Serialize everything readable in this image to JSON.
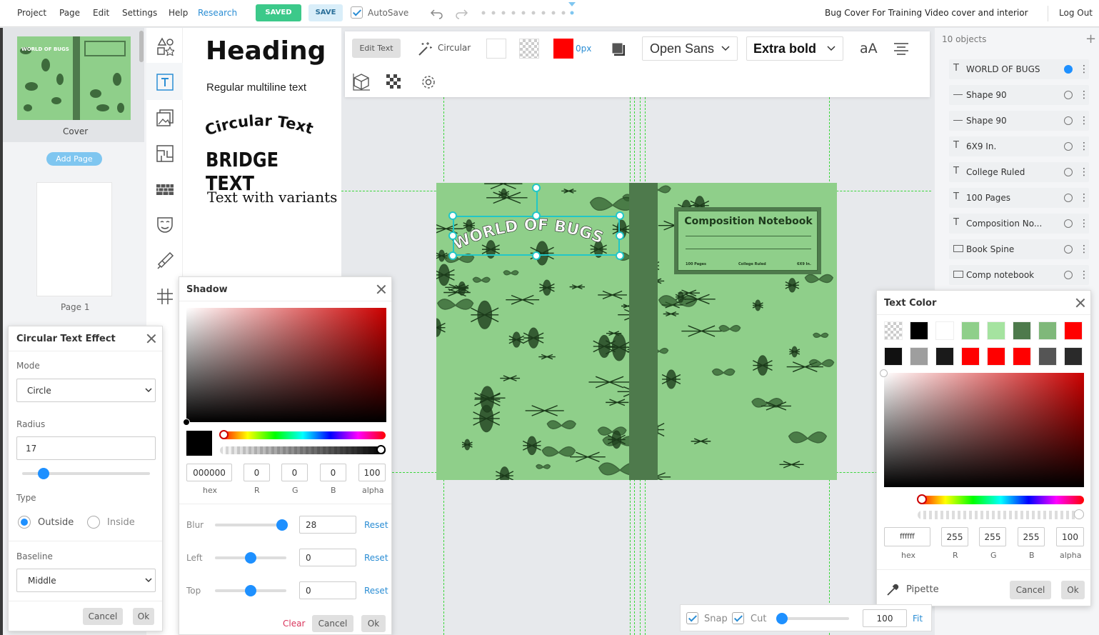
{
  "menu": {
    "project": "Project",
    "page": "Page",
    "edit": "Edit",
    "settings": "Settings",
    "help": "Help",
    "research": "Research"
  },
  "topbar": {
    "saved": "SAVED",
    "save": "SAVE",
    "autosave": "AutoSave",
    "document_title": "Bug Cover For Training Video cover and interior",
    "logout": "Log Out"
  },
  "pages": {
    "cover_label": "Cover",
    "add_page": "Add Page",
    "page1_label": "Page 1"
  },
  "text_presets": {
    "heading": "Heading",
    "multiline": "Regular multiline text",
    "circular": "Circular Text",
    "bridge": "BRIDGE TEXT",
    "variants": "Text with variants"
  },
  "toolbar": {
    "edit_text": "Edit Text",
    "circular": "Circular",
    "stroke_width": "0px",
    "font_family": "Open Sans",
    "font_weight": "Extra bold",
    "text_case": "aA",
    "fill_color": "#ff0000"
  },
  "layers": {
    "count": "10 objects",
    "items": [
      {
        "label": "WORLD OF BUGS",
        "icon": "text-icon"
      },
      {
        "label": "Shape 90",
        "icon": "line-icon"
      },
      {
        "label": "Shape 90",
        "icon": "line-icon"
      },
      {
        "label": "6X9 In.",
        "icon": "text-icon"
      },
      {
        "label": "College Ruled",
        "icon": "text-icon"
      },
      {
        "label": "100 Pages",
        "icon": "text-icon"
      },
      {
        "label": "Composition No...",
        "icon": "text-icon"
      },
      {
        "label": "Book Spine",
        "icon": "rect-icon"
      },
      {
        "label": "Comp notebook",
        "icon": "rect-icon"
      }
    ]
  },
  "canvas": {
    "cover_title": "WORLD OF BUGS",
    "notebook_title": "Composition Notebook",
    "meta_pages": "100 Pages",
    "meta_ruled": "College Ruled",
    "meta_size": "6X9 In.",
    "cover_color": "#8fcf8a",
    "spine_color": "#4e7a4c"
  },
  "circular_panel": {
    "title": "Circular Text Effect",
    "mode_label": "Mode",
    "mode_value": "Circle",
    "radius_label": "Radius",
    "radius_value": "17",
    "radius_slider": 0.17,
    "type_label": "Type",
    "outside": "Outside",
    "inside": "Inside",
    "baseline_label": "Baseline",
    "baseline_value": "Middle",
    "cancel": "Cancel",
    "ok": "Ok"
  },
  "shadow_panel": {
    "title": "Shadow",
    "hex": "000000",
    "r": "0",
    "g": "0",
    "b": "0",
    "alpha": "100",
    "hex_label": "hex",
    "r_label": "R",
    "g_label": "G",
    "b_label": "B",
    "alpha_label": "alpha",
    "blur_label": "Blur",
    "blur_value": "28",
    "left_label": "Left",
    "left_value": "0",
    "top_label": "Top",
    "top_value": "0",
    "reset": "Reset",
    "clear": "Clear",
    "cancel": "Cancel",
    "ok": "Ok"
  },
  "text_color_panel": {
    "title": "Text Color",
    "swatches": [
      "transparent",
      "#000000",
      "#ffffff",
      "#8fcf8a",
      "#a5e3a0",
      "#4e7a4c",
      "#7fb87a",
      "#ff0000",
      "#111111",
      "#9e9e9e",
      "#1a1a1a",
      "#ff0000",
      "#ff0000",
      "#ff0000",
      "#555555",
      "#2a2a2a"
    ],
    "hex": "ffffff",
    "r": "255",
    "g": "255",
    "b": "255",
    "alpha": "100",
    "hex_label": "hex",
    "r_label": "R",
    "g_label": "G",
    "b_label": "B",
    "alpha_label": "alpha",
    "pipette": "Pipette",
    "cancel": "Cancel",
    "ok": "Ok"
  },
  "zoom_bar": {
    "snap": "Snap",
    "cut": "Cut",
    "zoom": "100",
    "fit": "Fit"
  }
}
